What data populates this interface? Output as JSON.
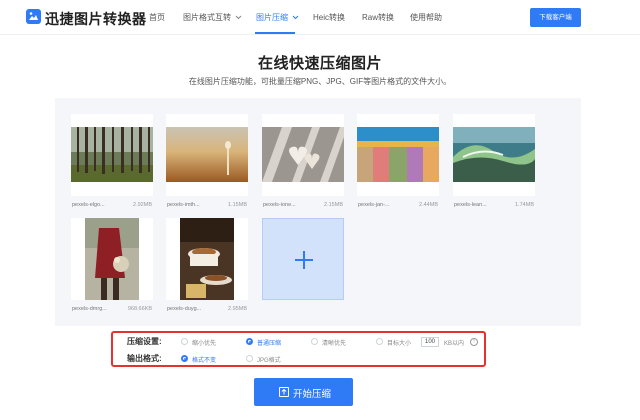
{
  "header": {
    "brand": "迅捷图片转换器",
    "nav": [
      {
        "label": "首页"
      },
      {
        "label": "图片格式互转"
      },
      {
        "label": "图片压缩"
      },
      {
        "label": "Heic转换"
      },
      {
        "label": "Raw转换"
      },
      {
        "label": "使用帮助"
      }
    ],
    "active_nav": "图片压缩",
    "download_label": "下载客户端"
  },
  "hero": {
    "title": "在线快速压缩图片",
    "subtitle": "在线图片压缩功能，可批量压缩PNG、JPG、GIF等图片格式的文件大小。"
  },
  "files": [
    {
      "name": "pexels-elgo...",
      "size": "2.92MB",
      "icon": "forest-photo"
    },
    {
      "name": "pexels-imth...",
      "size": "1.15MB",
      "icon": "grass-field-photo"
    },
    {
      "name": "pexels-ione...",
      "size": "2.15MB",
      "icon": "glass-hearts-photo"
    },
    {
      "name": "pexels-jan-...",
      "size": "2.44MB",
      "icon": "colorful-wall-photo"
    },
    {
      "name": "pexels-lean...",
      "size": "1.74MB",
      "icon": "wave-photo"
    },
    {
      "name": "pexels-dmrg...",
      "size": "968.66KB",
      "icon": "woman-flowers-photo"
    },
    {
      "name": "pexels-duyg...",
      "size": "2.95MB",
      "icon": "coffee-cup-photo"
    }
  ],
  "settings": {
    "compress_label": "压缩设置:",
    "compress_options": [
      "缩小优先",
      "普通压缩",
      "清晰优先",
      "目标大小"
    ],
    "compress_selected": "普通压缩",
    "target_size_value": "100",
    "target_size_unit": "KB以内",
    "info_glyph": "!",
    "output_label": "输出格式:",
    "output_options": [
      "格式不变",
      "JPG格式"
    ],
    "output_selected": "格式不变"
  },
  "start_button": {
    "label": "开始压缩",
    "icon": "upload-icon"
  },
  "colors": {
    "accent": "#2f7bf5",
    "highlight_border": "#e6312d",
    "panel_bg": "#f4f6f9"
  }
}
